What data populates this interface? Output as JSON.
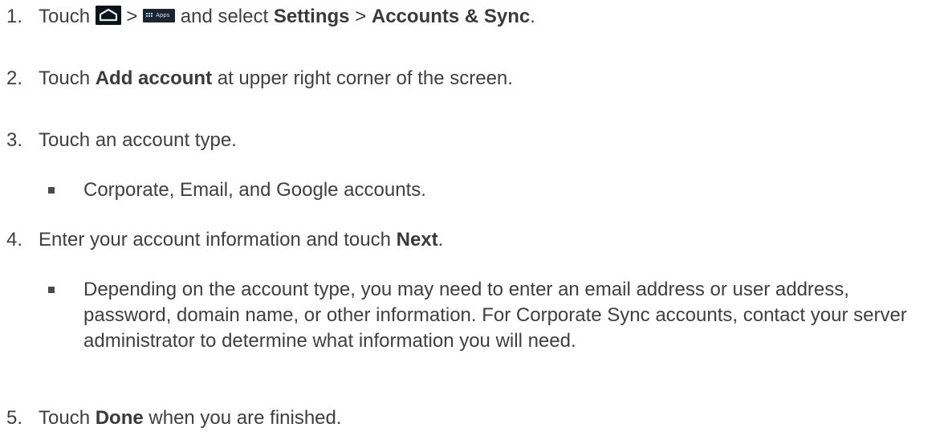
{
  "steps": [
    {
      "number": "1.",
      "parts": {
        "touch": "Touch",
        "sep1": ">",
        "apps_icon_label": "Apps",
        "and_select": "and select",
        "settings": "Settings",
        "sep2": ">",
        "accounts_sync": "Accounts & Sync",
        "end": "."
      }
    },
    {
      "number": "2.",
      "parts": {
        "touch": "Touch",
        "add_account": "Add account",
        "rest": "at upper right corner of the screen."
      }
    },
    {
      "number": "3.",
      "text": "Touch an account type.",
      "bullet": "Corporate, Email, and Google accounts."
    },
    {
      "number": "4.",
      "parts": {
        "prefix": "Enter your account information and touch",
        "next": "Next",
        "end": "."
      },
      "bullet": "Depending on the account type, you may need to enter an email address or user address, password, domain name, or other information. For Corporate Sync accounts, contact your server administrator to determine what information you will need."
    },
    {
      "number": "5.",
      "parts": {
        "touch": "Touch",
        "done": "Done",
        "rest": "when you are finished."
      }
    }
  ]
}
